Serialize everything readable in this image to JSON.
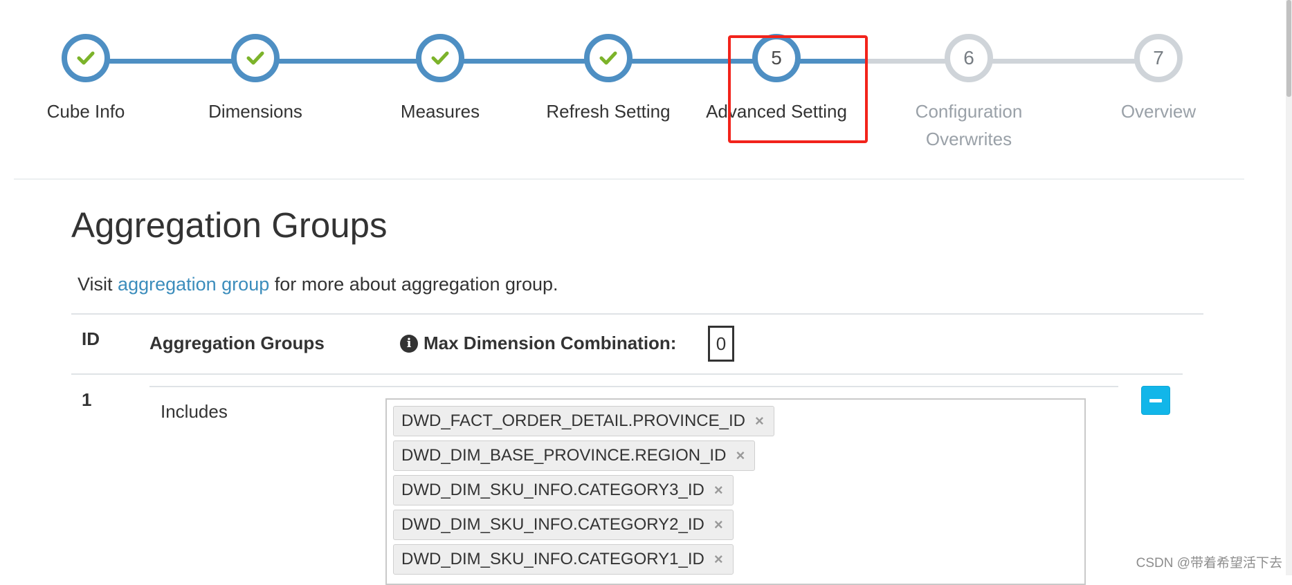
{
  "wizard": {
    "steps": [
      {
        "number": "1",
        "label": "Cube Info",
        "state": "done"
      },
      {
        "number": "2",
        "label": "Dimensions",
        "state": "done"
      },
      {
        "number": "3",
        "label": "Measures",
        "state": "done"
      },
      {
        "number": "4",
        "label": "Refresh Setting",
        "state": "done"
      },
      {
        "number": "5",
        "label": "Advanced Setting",
        "state": "active"
      },
      {
        "number": "6",
        "label": "Configuration Overwrites",
        "state": "todo"
      },
      {
        "number": "7",
        "label": "Overview",
        "state": "todo"
      }
    ],
    "colors": {
      "done": "#4e8fc3",
      "todo": "#cfd4d9",
      "check": "#7cb32a",
      "highlight": "#f2231b"
    }
  },
  "section": {
    "title": "Aggregation Groups",
    "intro_prefix": "Visit",
    "intro_link": "aggregation group",
    "intro_suffix": "for more about aggregation group."
  },
  "table": {
    "headers": {
      "id": "ID",
      "groups": "Aggregation Groups",
      "max_dim": "Max Dimension Combination:"
    },
    "max_dim_value": "0",
    "info_icon": "info-icon",
    "rows": [
      {
        "id": "1",
        "includes_label": "Includes",
        "includes": [
          "DWD_FACT_ORDER_DETAIL.PROVINCE_ID",
          "DWD_DIM_BASE_PROVINCE.REGION_ID",
          "DWD_DIM_SKU_INFO.CATEGORY3_ID",
          "DWD_DIM_SKU_INFO.CATEGORY2_ID",
          "DWD_DIM_SKU_INFO.CATEGORY1_ID"
        ],
        "tag_remove_symbol": "×",
        "remove_icon": "minus-icon"
      }
    ]
  },
  "watermark": "CSDN @带着希望活下去"
}
